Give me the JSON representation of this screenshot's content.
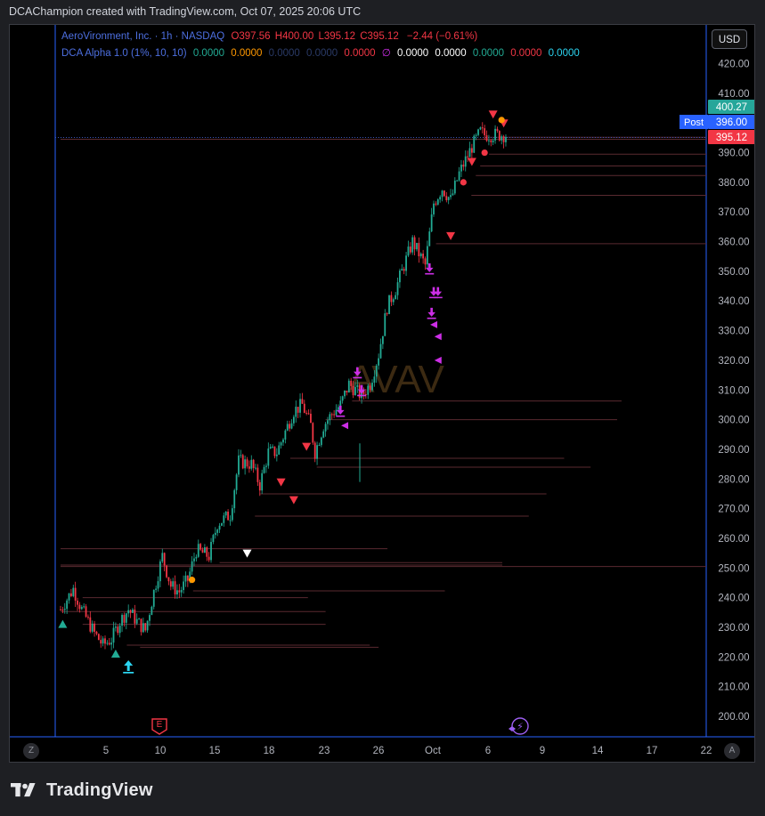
{
  "header": {
    "attribution": "DCAChampion created with TradingView.com, Oct 07, 2025 20:06 UTC"
  },
  "legend": {
    "symbol": "AeroVironment, Inc. · 1h · NASDAQ",
    "open": "O397.56",
    "high": "H400.00",
    "low": "L395.12",
    "close": "C395.12",
    "change": "−2.44 (−0.61%)",
    "indicator": "DCA Alpha 1.0 (1%, 10, 10)",
    "indicator_values": [
      "0.0000",
      "0.0000",
      "0.0000",
      "0.0000",
      "0.0000",
      "∅",
      "0.0000",
      "0.0000",
      "0.0000",
      "0.0000",
      "0.0000"
    ]
  },
  "toolbar": {
    "currency": "USD",
    "left_button": "Z",
    "right_button": "A"
  },
  "watermark": "AVAV",
  "footer": {
    "brand": "TradingView"
  },
  "colors": {
    "up": "#22ab94",
    "down": "#f23645",
    "magenta": "#cc2ee6",
    "blue_line": "#2962ff",
    "axis_text": "#b2b5be",
    "level_line": "#5a2a30",
    "post": "#2962ff",
    "teal": "#26a69a"
  },
  "chart_data": {
    "type": "candlestick",
    "y_ticks": [
      200,
      210,
      220,
      230,
      240,
      250,
      260,
      270,
      280,
      290,
      300,
      310,
      320,
      330,
      340,
      350,
      360,
      370,
      380,
      390,
      400,
      410,
      420
    ],
    "y_tick_labels": [
      "200.00",
      "210.00",
      "220.00",
      "230.00",
      "240.00",
      "250.00",
      "260.00",
      "270.00",
      "280.00",
      "290.00",
      "300.00",
      "310.00",
      "320.00",
      "330.00",
      "340.00",
      "350.00",
      "360.00",
      "370.00",
      "380.00",
      "390.00",
      "400.00",
      "410.00",
      "420.00"
    ],
    "ylim": [
      194,
      428
    ],
    "x_labels": [
      "5",
      "10",
      "15",
      "18",
      "23",
      "26",
      "Oct",
      "6",
      "9",
      "14",
      "17",
      "22"
    ],
    "price_labels": [
      {
        "text": "400.27",
        "value": 400.27,
        "color": "#26a69a"
      },
      {
        "text": "396.00",
        "value": 396.0,
        "color": "#2962ff",
        "tag": "Post"
      },
      {
        "text": "395.12",
        "value": 395.12,
        "color": "#f23645"
      }
    ],
    "path": [
      [
        0,
        236
      ],
      [
        3,
        243
      ],
      [
        5,
        236
      ],
      [
        8,
        228
      ],
      [
        10,
        224
      ],
      [
        12,
        226
      ],
      [
        14,
        232
      ],
      [
        16,
        236
      ],
      [
        18,
        232
      ],
      [
        20,
        229
      ],
      [
        22,
        242
      ],
      [
        24,
        254
      ],
      [
        26,
        244
      ],
      [
        28,
        242
      ],
      [
        30,
        246
      ],
      [
        32,
        256
      ],
      [
        35,
        254
      ],
      [
        37,
        265
      ],
      [
        40,
        268
      ],
      [
        42,
        286
      ],
      [
        45,
        285
      ],
      [
        47,
        278
      ],
      [
        49,
        289
      ],
      [
        51,
        289
      ],
      [
        53,
        296
      ],
      [
        55,
        303
      ],
      [
        57,
        305
      ],
      [
        59,
        298
      ],
      [
        60,
        289
      ],
      [
        62,
        298
      ],
      [
        64,
        302
      ],
      [
        66,
        305
      ],
      [
        68,
        312
      ],
      [
        71,
        308
      ],
      [
        73,
        312
      ],
      [
        75,
        322
      ],
      [
        77,
        338
      ],
      [
        79,
        344
      ],
      [
        81,
        352
      ],
      [
        83,
        360
      ],
      [
        86,
        352
      ],
      [
        88,
        373
      ],
      [
        90,
        378
      ],
      [
        92,
        374
      ],
      [
        94,
        383
      ],
      [
        97,
        392
      ],
      [
        99,
        397
      ],
      [
        100,
        396
      ]
    ],
    "levels": [
      {
        "price": 395.2,
        "x0": 97,
        "x1": 164
      },
      {
        "price": 394.5,
        "x0": 0,
        "x1": 164
      },
      {
        "price": 389.5,
        "x0": 97,
        "x1": 164
      },
      {
        "price": 385.5,
        "x0": 95,
        "x1": 164
      },
      {
        "price": 382.3,
        "x0": 94,
        "x1": 164
      },
      {
        "price": 375.6,
        "x0": 93,
        "x1": 160
      },
      {
        "price": 359.3,
        "x0": 85,
        "x1": 157
      },
      {
        "price": 306.3,
        "x0": 66,
        "x1": 127
      },
      {
        "price": 300.0,
        "x0": 60,
        "x1": 126
      },
      {
        "price": 287.0,
        "x0": 52,
        "x1": 114
      },
      {
        "price": 284.0,
        "x0": 58,
        "x1": 120
      },
      {
        "price": 275.0,
        "x0": 45,
        "x1": 110
      },
      {
        "price": 267.5,
        "x0": 44,
        "x1": 106
      },
      {
        "price": 256.5,
        "x0": 0,
        "x1": 74
      },
      {
        "price": 251.8,
        "x0": 36,
        "x1": 100
      },
      {
        "price": 251.0,
        "x0": 0,
        "x1": 100
      },
      {
        "price": 250.5,
        "x0": 0,
        "x1": 170
      },
      {
        "price": 242.3,
        "x0": 30,
        "x1": 87
      },
      {
        "price": 240.0,
        "x0": 5,
        "x1": 56
      },
      {
        "price": 235.3,
        "x0": 0,
        "x1": 60
      },
      {
        "price": 231.0,
        "x0": 5,
        "x1": 60
      },
      {
        "price": 224.0,
        "x0": 15,
        "x1": 70
      },
      {
        "price": 223.3,
        "x0": 18,
        "x1": 72
      }
    ],
    "markers": [
      {
        "type": "tri-up",
        "x": 0.5,
        "price": 231,
        "color": "#22ab94"
      },
      {
        "type": "tri-up",
        "x": 13,
        "price": 221,
        "color": "#22ab94"
      },
      {
        "type": "arrow-up",
        "x": 16,
        "price": 218,
        "color": "#2bd4f0"
      },
      {
        "type": "dot",
        "x": 31,
        "price": 246,
        "color": "#ff9800"
      },
      {
        "type": "tri-down",
        "x": 44,
        "price": 255,
        "color": "#ffffff"
      },
      {
        "type": "tri-down",
        "x": 52,
        "price": 279,
        "color": "#f23645"
      },
      {
        "type": "tri-down",
        "x": 55,
        "price": 273,
        "color": "#f23645"
      },
      {
        "type": "tri-down",
        "x": 58,
        "price": 291,
        "color": "#f23645"
      },
      {
        "type": "arrow-down",
        "x": 66,
        "price": 302,
        "color": "#cc2ee6"
      },
      {
        "type": "arrow-down",
        "x": 70,
        "price": 315,
        "color": "#cc2ee6"
      },
      {
        "type": "arrow-down",
        "x": 71,
        "price": 309,
        "color": "#cc2ee6"
      },
      {
        "type": "arrow-down",
        "x": 87,
        "price": 350,
        "color": "#cc2ee6"
      },
      {
        "type": "arrow-down",
        "x": 88,
        "price": 342,
        "color": "#cc2ee6"
      },
      {
        "type": "arrow-down",
        "x": 89,
        "price": 342,
        "color": "#cc2ee6"
      },
      {
        "type": "arrow-down",
        "x": 87.5,
        "price": 335,
        "color": "#cc2ee6"
      },
      {
        "type": "tri-left",
        "x": 67,
        "price": 298,
        "color": "#cc2ee6"
      },
      {
        "type": "tri-left",
        "x": 88,
        "price": 332,
        "color": "#cc2ee6"
      },
      {
        "type": "tri-left",
        "x": 89,
        "price": 328,
        "color": "#cc2ee6"
      },
      {
        "type": "tri-left",
        "x": 89,
        "price": 320,
        "color": "#cc2ee6"
      },
      {
        "type": "tri-down",
        "x": 92,
        "price": 362,
        "color": "#f23645"
      },
      {
        "type": "tri-down",
        "x": 97,
        "price": 387,
        "color": "#f23645"
      },
      {
        "type": "dot",
        "x": 95,
        "price": 380,
        "color": "#f23645"
      },
      {
        "type": "dot",
        "x": 100,
        "price": 390,
        "color": "#f23645"
      },
      {
        "type": "tri-down",
        "x": 102,
        "price": 403,
        "color": "#f23645"
      },
      {
        "type": "tri-down",
        "x": 104.5,
        "price": 400,
        "color": "#f23645"
      },
      {
        "type": "dot",
        "x": 104,
        "price": 401,
        "color": "#ff9800"
      }
    ],
    "events": [
      {
        "type": "earnings",
        "label": "E",
        "x_label_index": 1.0
      },
      {
        "type": "dividend",
        "label": "⚡",
        "x_label_index": 6.98
      }
    ]
  }
}
